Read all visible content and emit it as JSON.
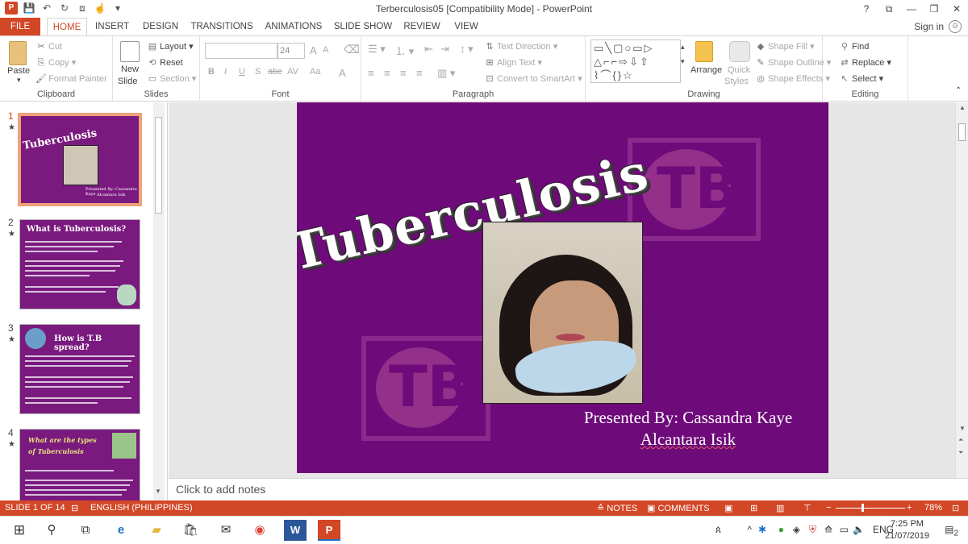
{
  "window": {
    "title": "Terberculosis05 [Compatibility Mode] - PowerPoint",
    "controls": [
      "?",
      "⧉",
      "—",
      "❐",
      "✕"
    ]
  },
  "qat": {
    "icons": [
      "powerpoint-icon",
      "save-icon",
      "undo-icon",
      "redo-icon",
      "start-from-beginning-icon",
      "touch-mode-icon",
      "customize-icon"
    ]
  },
  "tabs": {
    "file": "FILE",
    "items": [
      "HOME",
      "INSERT",
      "DESIGN",
      "TRANSITIONS",
      "ANIMATIONS",
      "SLIDE SHOW",
      "REVIEW",
      "VIEW"
    ],
    "active": "HOME",
    "signin": "Sign in"
  },
  "ribbon": {
    "clipboard": {
      "paste": "Paste",
      "cut": "Cut",
      "copy": "Copy",
      "format_painter": "Format Painter",
      "label": "Clipboard"
    },
    "slides": {
      "new_slide_line1": "New",
      "new_slide_line2": "Slide",
      "layout": "Layout",
      "reset": "Reset",
      "section": "Section",
      "label": "Slides"
    },
    "font": {
      "font_size": "24",
      "label": "Font",
      "bold": "B",
      "italic": "I",
      "underline": "U",
      "shadow": "S",
      "strike": "abc",
      "spacing": "AV",
      "case": "Aa",
      "grow": "A",
      "shrink": "A",
      "color": "A"
    },
    "paragraph": {
      "text_direction": "Text Direction",
      "align_text": "Align Text",
      "convert_smartart": "Convert to SmartArt",
      "label": "Paragraph"
    },
    "drawing": {
      "arrange": "Arrange",
      "quick_styles_line1": "Quick",
      "quick_styles_line2": "Styles",
      "shape_fill": "Shape Fill",
      "shape_outline": "Shape Outline",
      "shape_effects": "Shape Effects",
      "label": "Drawing"
    },
    "editing": {
      "find": "Find",
      "replace": "Replace",
      "select": "Select",
      "label": "Editing"
    }
  },
  "thumbnails": [
    {
      "num": "1",
      "title": "Tuberculosis",
      "presenter_line1": "Presented By: Cassandra Kaye",
      "presenter_line2": "Alcantara Isik"
    },
    {
      "num": "2",
      "title": "What is Tuberculosis?"
    },
    {
      "num": "3",
      "title": "How is T.B spread?"
    },
    {
      "num": "4",
      "title": "What are the types of Tuberculosis"
    }
  ],
  "slide": {
    "title": "Tuberculosis",
    "presenter_line1": "Presented By: Cassandra Kaye",
    "presenter_line2": "Alcantara Isik",
    "watermark_text": "TB"
  },
  "notes": {
    "placeholder": "Click to add notes"
  },
  "status": {
    "slide_of": "SLIDE 1 OF 14",
    "language": "ENGLISH (PHILIPPINES)",
    "notes": "NOTES",
    "comments": "COMMENTS",
    "zoom": "78%"
  },
  "taskbar": {
    "language": "ENG",
    "time": "7:25 PM",
    "date": "21/07/2019",
    "notification_count": "2"
  },
  "colors": {
    "accent": "#d24726",
    "slide_bg": "#6e0a7a"
  }
}
